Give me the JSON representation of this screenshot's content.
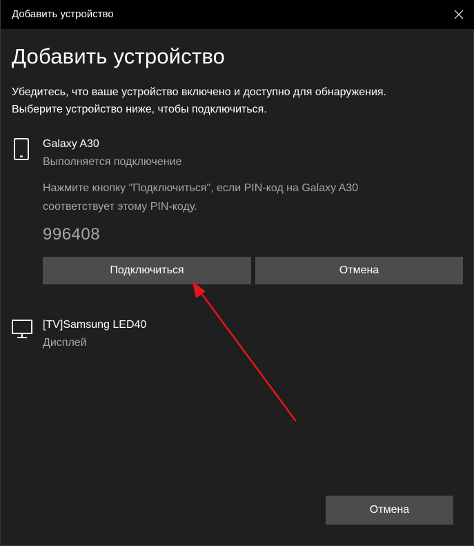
{
  "window": {
    "title": "Добавить устройство"
  },
  "header": {
    "title": "Добавить устройство",
    "instruction_line1": "Убедитесь, что ваше устройство включено и доступно для обнаружения.",
    "instruction_line2": "Выберите устройство ниже, чтобы подключиться."
  },
  "devices": [
    {
      "name": "Galaxy A30",
      "status": "Выполняется подключение",
      "icon": "phone-icon",
      "pin_prompt_line1": "Нажмите кнопку \"Подключиться\", если PIN-код на Galaxy A30",
      "pin_prompt_line2": "соответствует этому PIN-коду.",
      "pin": "996408",
      "connect_label": "Подключиться",
      "cancel_label": "Отмена"
    },
    {
      "name": "[TV]Samsung LED40",
      "status": "Дисплей",
      "icon": "monitor-icon"
    }
  ],
  "footer": {
    "cancel_label": "Отмена"
  },
  "colors": {
    "background": "#1f1f1f",
    "titlebar": "#000000",
    "button": "#4c4c4c",
    "secondary_text": "#a6a6a6",
    "annotation_arrow": "#e8141b"
  }
}
